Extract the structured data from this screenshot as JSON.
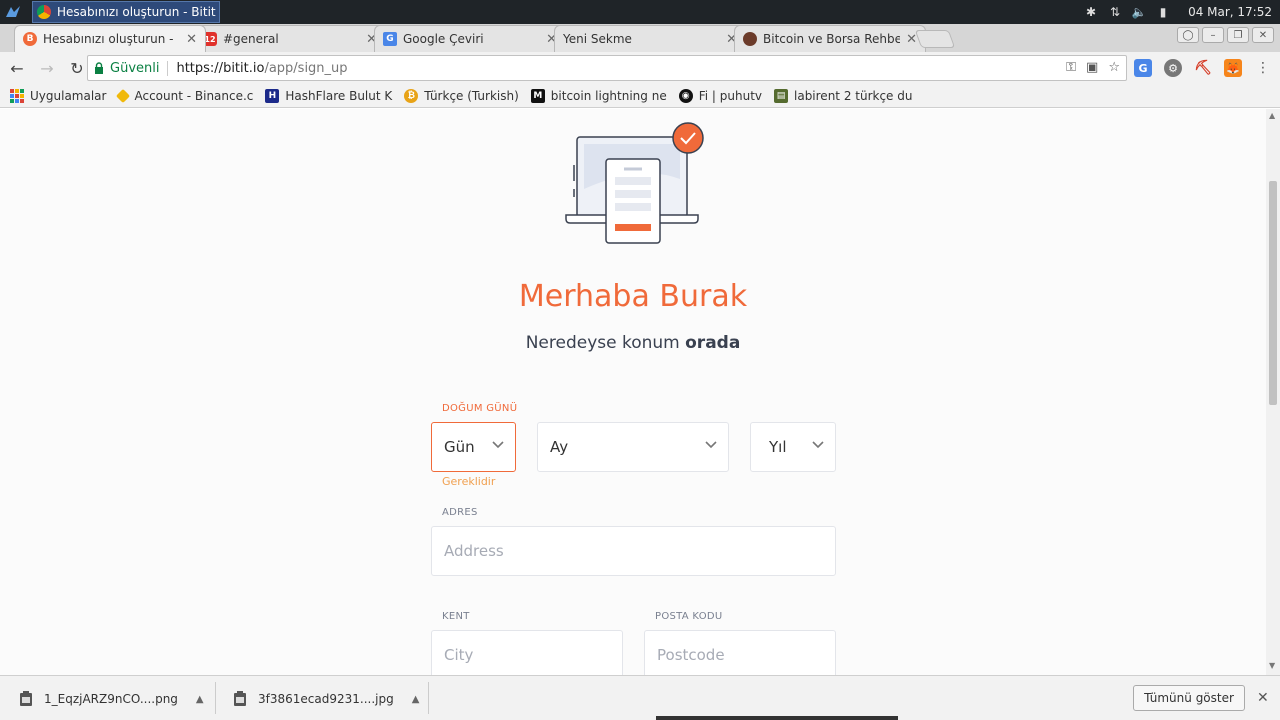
{
  "os": {
    "active_window": "Hesabınızı oluşturun - Bitit ...",
    "datetime": "04 Mar, 17:52"
  },
  "tabs": [
    {
      "title": "Hesabınızı oluşturun -",
      "favicon_color": "#f06a3a",
      "favicon_glyph": "B"
    },
    {
      "title": "#general",
      "favicon_color": "#e0312b",
      "favicon_glyph": "12"
    },
    {
      "title": "Google Çeviri",
      "favicon_color": "#4a86e8",
      "favicon_glyph": "G"
    },
    {
      "title": "Yeni Sekme",
      "favicon_color": "",
      "favicon_glyph": ""
    },
    {
      "title": "Bitcoin ve Borsa Rehbe",
      "favicon_color": "#6b3b2a",
      "favicon_glyph": ""
    }
  ],
  "address_bar": {
    "secure_label": "Güvenli",
    "url_host": "https://bitit.io",
    "url_path": "/app/sign_up"
  },
  "bookmarks": [
    {
      "label": "Uygulamalar",
      "icon": "apps-grid-icon"
    },
    {
      "label": "Account - Binance.c",
      "icon": "binance-icon",
      "color": "#f0b90b"
    },
    {
      "label": "HashFlare Bulut K",
      "icon": "hashflare-icon",
      "color": "#1c2a8a"
    },
    {
      "label": "Türkçe (Turkish)",
      "icon": "bitcoin-coin-icon",
      "color": "#e8a317"
    },
    {
      "label": "bitcoin lightning ne",
      "icon": "medium-icon",
      "color": "#111111"
    },
    {
      "label": "Fi | puhutv",
      "icon": "puhutv-icon",
      "color": "#111111"
    },
    {
      "label": "labirent 2 türkçe du",
      "icon": "film-icon",
      "color": "#556b2f"
    }
  ],
  "page": {
    "greeting": "Merhaba Burak",
    "subtitle_prefix": "Neredeyse konum ",
    "subtitle_bold": "orada",
    "accent_color": "#f06a3a",
    "birthday": {
      "label": "DOĞUM GÜNÜ",
      "day_placeholder": "Gün",
      "month_placeholder": "Ay",
      "year_placeholder": "Yıl",
      "error": "Gereklidir"
    },
    "address": {
      "label": "ADRES",
      "placeholder": "Address"
    },
    "city": {
      "label": "KENT",
      "placeholder": "City"
    },
    "postcode": {
      "label": "POSTA KODU",
      "placeholder": "Postcode"
    }
  },
  "downloads": {
    "items": [
      {
        "filename": "1_EqzjARZ9nCO....png"
      },
      {
        "filename": "3f3861ecad9231....jpg"
      }
    ],
    "show_all": "Tümünü göster"
  }
}
